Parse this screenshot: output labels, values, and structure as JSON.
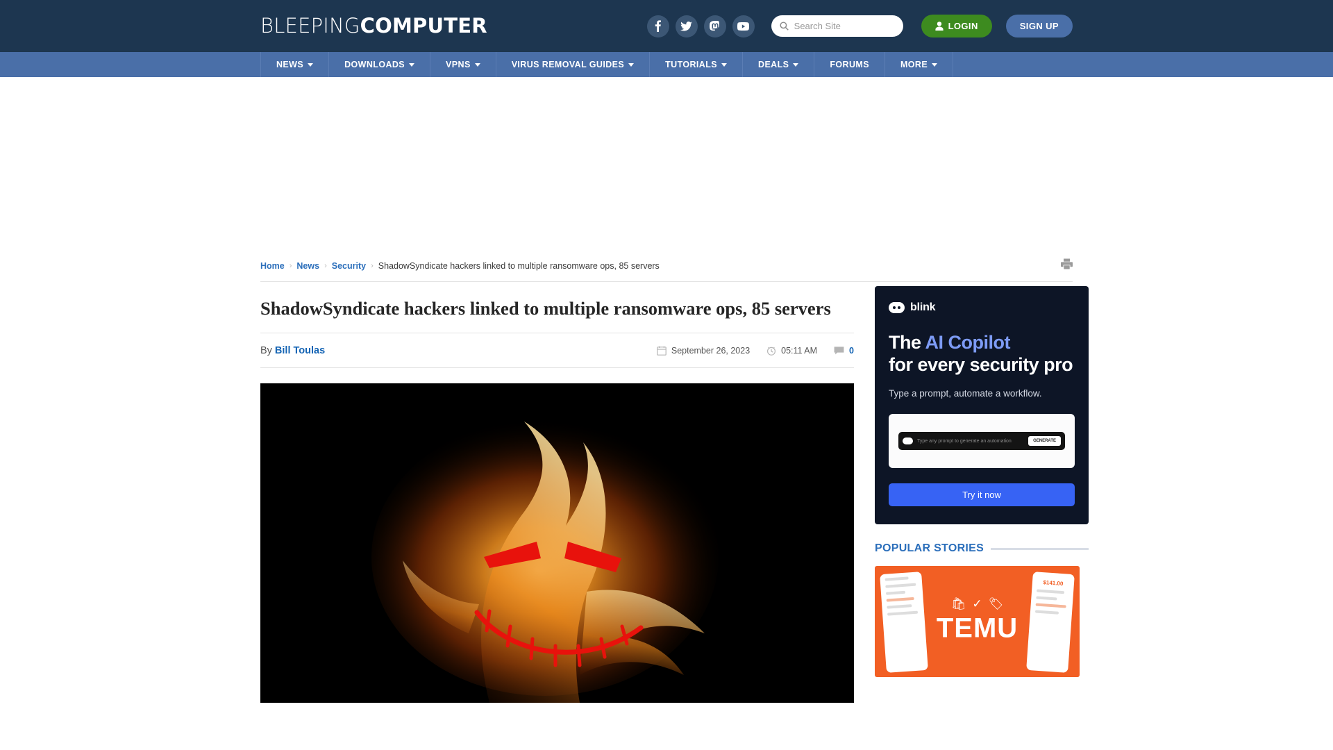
{
  "header": {
    "logo_thin": "BLEEPING",
    "logo_bold": "COMPUTER",
    "social": [
      {
        "name": "facebook",
        "label": "Facebook"
      },
      {
        "name": "twitter",
        "label": "Twitter"
      },
      {
        "name": "mastodon",
        "label": "Mastodon"
      },
      {
        "name": "youtube",
        "label": "YouTube"
      }
    ],
    "search": {
      "placeholder": "Search Site",
      "value": ""
    },
    "login_label": "LOGIN",
    "signup_label": "SIGN UP",
    "colors": {
      "header_bg": "#1d3650",
      "nav_bg": "#4a6fa8",
      "login_green": "#3d8b1f",
      "signup_blue": "#4a6fa8"
    }
  },
  "nav": {
    "items": [
      {
        "label": "NEWS",
        "has_dropdown": true
      },
      {
        "label": "DOWNLOADS",
        "has_dropdown": true
      },
      {
        "label": "VPNS",
        "has_dropdown": true
      },
      {
        "label": "VIRUS REMOVAL GUIDES",
        "has_dropdown": true
      },
      {
        "label": "TUTORIALS",
        "has_dropdown": true
      },
      {
        "label": "DEALS",
        "has_dropdown": true
      },
      {
        "label": "FORUMS",
        "has_dropdown": false
      },
      {
        "label": "MORE",
        "has_dropdown": true
      }
    ]
  },
  "breadcrumb": {
    "items": [
      {
        "label": "Home",
        "link": true
      },
      {
        "label": "News",
        "link": true
      },
      {
        "label": "Security",
        "link": true
      },
      {
        "label": "ShadowSyndicate hackers linked to multiple ransomware ops, 85 servers",
        "link": false
      }
    ],
    "separator": "›",
    "print_icon": "printer-icon"
  },
  "article": {
    "title": "ShadowSyndicate hackers linked to multiple ransomware ops, 85 servers",
    "by_label": "By",
    "author": "Bill Toulas",
    "date": "September 26, 2023",
    "time": "05:11 AM",
    "comment_count": "0",
    "hero_alt": "Fiery skull with red eyes and stitched grin on black background"
  },
  "sidebar": {
    "ad": {
      "brand": "blink",
      "headline_part1": "The ",
      "headline_accent": "AI Copilot",
      "headline_part2": "for every security pro",
      "subtext": "Type a prompt, automate a workflow.",
      "mock_placeholder": "Type any prompt to generate an automation",
      "mock_button": "GENERATE",
      "cta_label": "Try it now",
      "bg_color": "#0d1526",
      "accent_color": "#7d9bf5",
      "cta_color": "#3763f4"
    },
    "popular": {
      "title": "POPULAR STORIES",
      "thumb_brand": "TEMU",
      "thumb_price": "$141.00",
      "accent_color": "#2c6fbb"
    }
  }
}
